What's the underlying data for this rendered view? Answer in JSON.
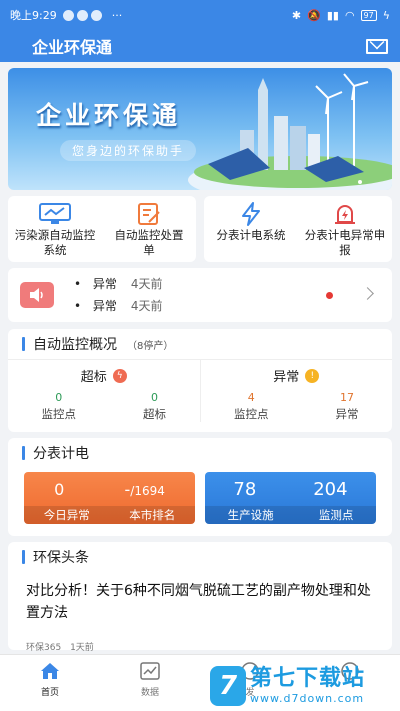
{
  "status_bar": {
    "time": "晚上9:29",
    "more": "···",
    "battery": "97"
  },
  "header": {
    "title": "企业环保通",
    "mail_icon": "mail-icon"
  },
  "banner": {
    "title": "企业环保通",
    "subtitle": "您身边的环保助手"
  },
  "functions": [
    {
      "label": "污染源自动监控系统",
      "icon": "monitor-icon"
    },
    {
      "label": "自动监控处置单",
      "icon": "edit-form-icon"
    },
    {
      "label": "分表计电系统",
      "icon": "lightning-icon"
    },
    {
      "label": "分表计电异常申报",
      "icon": "alarm-icon"
    }
  ],
  "notice": {
    "items": [
      {
        "text": "异常",
        "when": "4天前"
      },
      {
        "text": "异常",
        "when": "4天前"
      }
    ]
  },
  "monitor": {
    "title": "自动监控概况",
    "subtitle": "（8停产）",
    "exceed": {
      "label": "超标",
      "points": {
        "value": "0",
        "label": "监控点"
      },
      "count": {
        "value": "0",
        "label": "超标"
      },
      "color": "#2e9b58"
    },
    "abnormal": {
      "label": "异常",
      "points": {
        "value": "4",
        "label": "监控点"
      },
      "count": {
        "value": "17",
        "label": "异常"
      },
      "color": "#e0742e"
    }
  },
  "meter": {
    "title": "分表计电",
    "today_abnormal": {
      "value": "0",
      "label": "今日异常"
    },
    "city_rank": {
      "value": "-",
      "total": "/1694",
      "label": "本市排名"
    },
    "facilities": {
      "value": "78",
      "label": "生产设施"
    },
    "points": {
      "value": "204",
      "label": "监测点"
    }
  },
  "news": {
    "title": "环保头条",
    "headline": "对比分析！关于6种不同烟气脱硫工艺的副产物处理和处置方法",
    "source": "环保365",
    "time": "1天前"
  },
  "bottom_nav": [
    {
      "label": "首页",
      "icon": "home-icon",
      "active": true
    },
    {
      "label": "数据",
      "icon": "chart-icon",
      "active": false
    },
    {
      "label": "发",
      "icon": "discover-icon",
      "active": false
    },
    {
      "label": "",
      "icon": "profile-icon",
      "active": false
    }
  ],
  "watermark": {
    "name": "第七下载站",
    "url": "www.d7down.com",
    "logo": "7"
  },
  "colors": {
    "primary": "#3b87e6",
    "orange": "#f07a3c",
    "red_dot": "#e53935"
  }
}
